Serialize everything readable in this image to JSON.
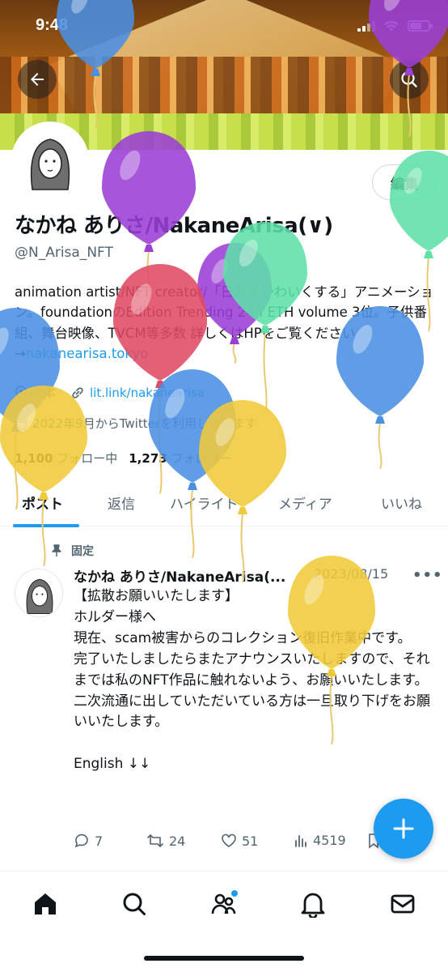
{
  "status_bar": {
    "time": "9:48"
  },
  "profile": {
    "edit_label": "編集",
    "name": "なかね ありさ/NakaneArisa(∨)",
    "handle": "@N_Arisa_NFT",
    "bio_text": "animation artist/NFT creator/「日常をかわいくする」アニメーション。foundationのEdition Trending 24h ETH volume 3位。子供番組、舞台映像、TVCM等多数 詳しくはHPをご覧ください→",
    "bio_link": "nakanearisa.tokyo",
    "location": "日本",
    "website": "lit.link/nakanearisa",
    "joined": "2022年9月からTwitterを利用しています",
    "following_count": "1,100",
    "following_label": "フォロー中",
    "followers_count": "1,273",
    "followers_label": "フォロワー"
  },
  "tabs": [
    "ポスト",
    "返信",
    "ハイライト",
    "メディア",
    "いいね"
  ],
  "tweet": {
    "pinned_label": "固定",
    "author": "なかね ありさ/NakaneArisa(...",
    "date": "2023/08/15",
    "more": "•••",
    "lines": [
      "【拡散お願いいたします】",
      "ホルダー様へ",
      "現在、scam被害からのコレクション復旧作業中です。",
      "完了いたしましたらまたアナウンスいたしますので、それまでは私のNFT作品に触れないよう、お願いいたします。",
      "二次流通に出していただいている方は一旦取り下げをお願いいたします。",
      "",
      "English ↓↓"
    ],
    "replies": "7",
    "retweets": "24",
    "likes": "51",
    "views": "4519"
  },
  "icons": {
    "back": "arrow-left-icon",
    "search": "search-icon",
    "compose": "plus-icon",
    "nav": [
      "home-icon",
      "search-icon",
      "communities-icon",
      "bell-icon",
      "mail-icon"
    ]
  },
  "balloon_colors": [
    "#4a90e2",
    "#9b3fd6",
    "#5ee0a8",
    "#e04a64",
    "#f0c93a"
  ]
}
